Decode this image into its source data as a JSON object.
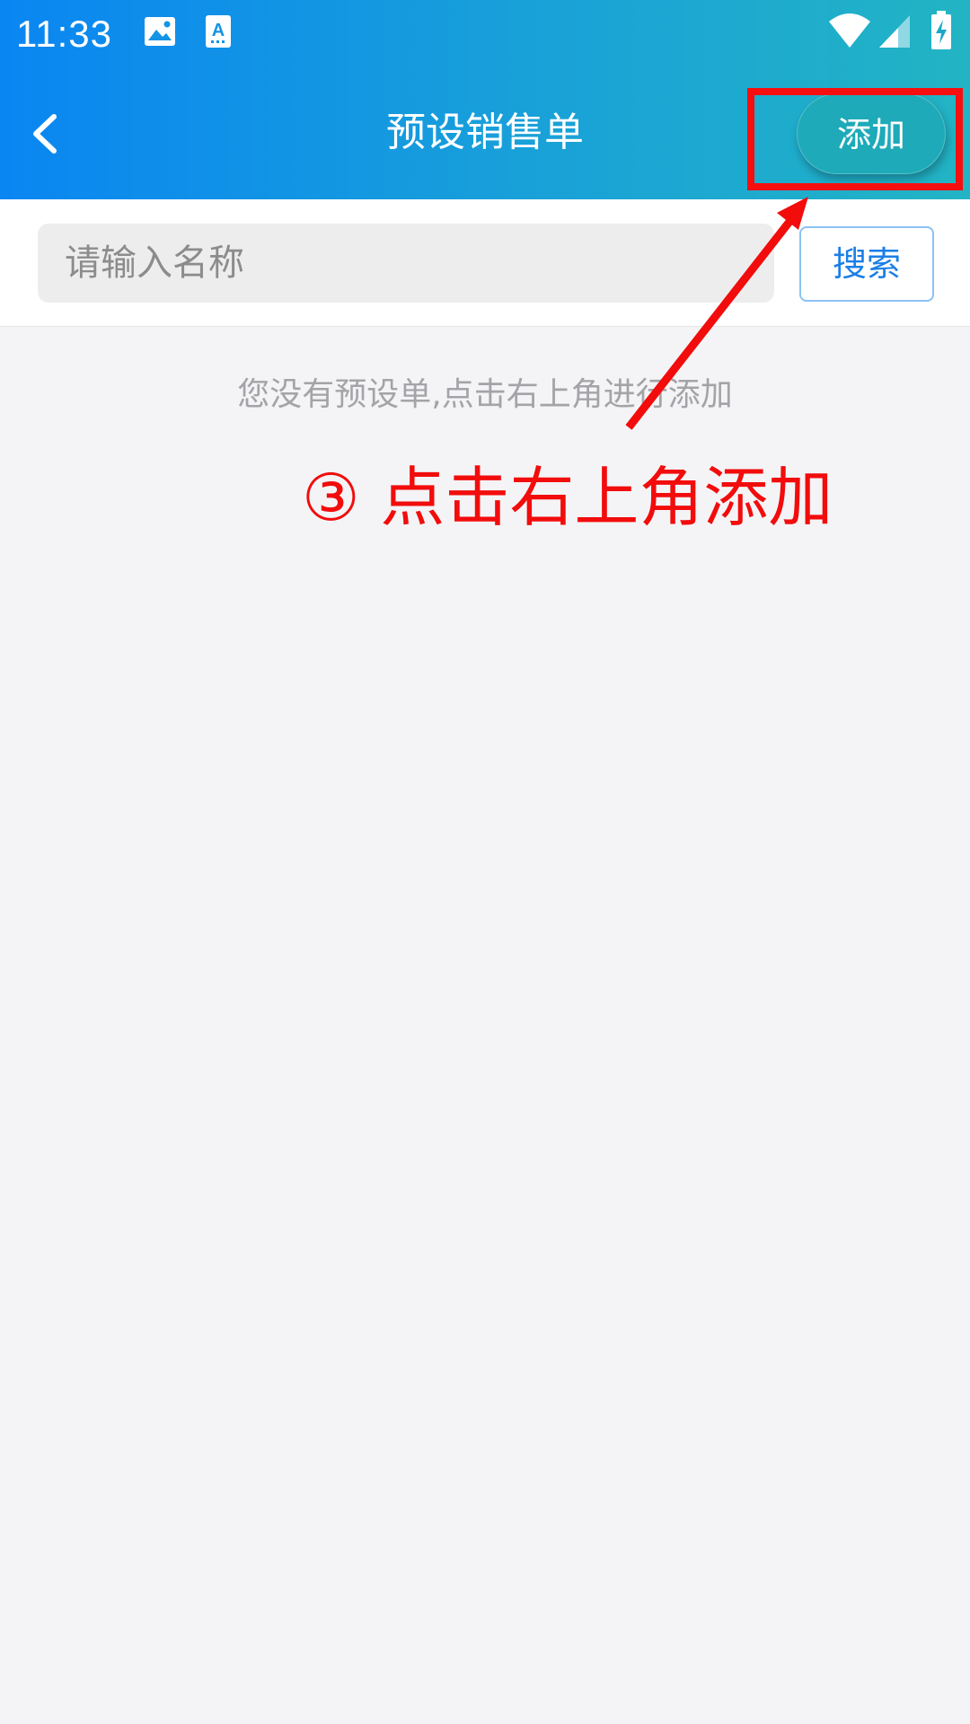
{
  "status_bar": {
    "time": "11:33",
    "icons": [
      "image-icon",
      "text-a-icon",
      "wifi-icon",
      "cell-signal-icon",
      "battery-charging-icon"
    ]
  },
  "nav": {
    "title": "预设销售单",
    "add_label": "添加",
    "back_icon": "chevron-left-icon"
  },
  "search": {
    "placeholder": "请输入名称",
    "button_label": "搜索"
  },
  "empty_message": "您没有预设单,点击右上角进行添加",
  "annotation": {
    "text": "③ 点击右上角添加",
    "color": "#f20c0c"
  },
  "colors": {
    "header_start": "#0a86f2",
    "header_end": "#22b4c4",
    "accent": "#1a7fe6",
    "background": "#f4f4f6"
  }
}
